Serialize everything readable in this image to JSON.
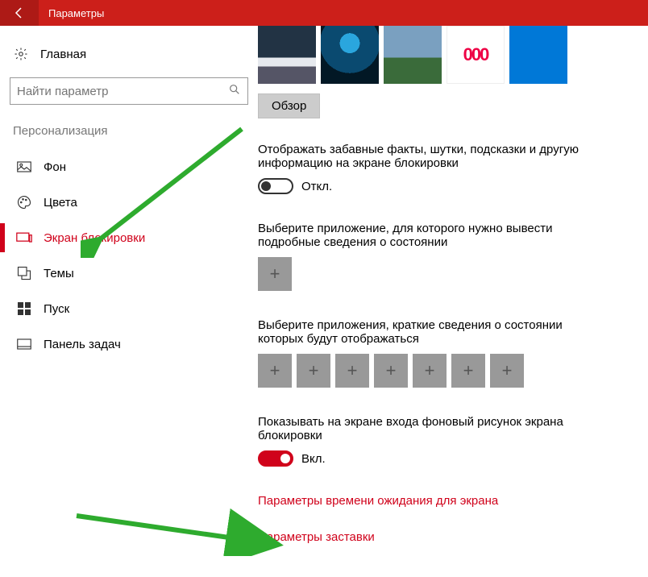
{
  "titlebar": {
    "title": "Параметры"
  },
  "home_label": "Главная",
  "search": {
    "placeholder": "Найти параметр"
  },
  "section": "Персонализация",
  "nav": {
    "background": "Фон",
    "colors": "Цвета",
    "lockscreen": "Экран блокировки",
    "themes": "Темы",
    "start": "Пуск",
    "taskbar": "Панель задач"
  },
  "thumb4_text": "000",
  "browse": "Обзор",
  "fun_facts_label": "Отображать забавные факты, шутки, подсказки и другую информацию на экране блокировки",
  "off_label": "Откл.",
  "detail_app_label": "Выберите приложение, для которого нужно вывести подробные сведения о состоянии",
  "quick_apps_label": "Выберите приложения, краткие сведения о состоянии которых будут отображаться",
  "signin_pic_label": "Показывать на экране входа фоновый рисунок экрана блокировки",
  "on_label": "Вкл.",
  "timeout_link": "Параметры времени ожидания для экрана",
  "screensaver_link": "Параметры заставки"
}
